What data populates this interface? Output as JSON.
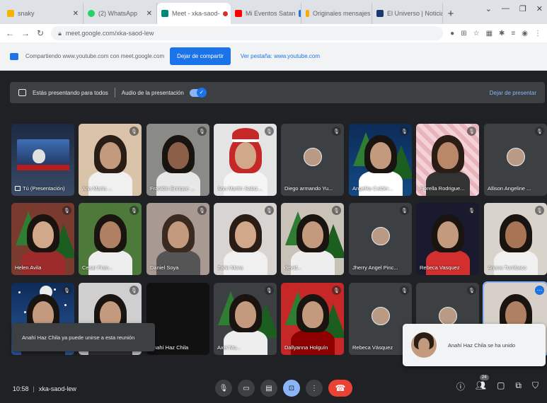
{
  "browser": {
    "tabs": [
      {
        "title": "snaky",
        "color": "#f4b400"
      },
      {
        "title": "(2) WhatsApp",
        "color": "#25d366"
      },
      {
        "title": "Meet - xka-saod-",
        "color": "#00897b"
      },
      {
        "title": "Mi Eventos Satan",
        "color": "#ff0000"
      },
      {
        "title": "Originales mensajes",
        "color": "#f9ab00"
      },
      {
        "title": "El Universo | Noticias",
        "color": "#1a3a6b"
      }
    ],
    "url": "meet.google.com/xka-saod-lew"
  },
  "sharebar": {
    "text": "Compartiendo www.youtube.com con meet.google.com",
    "share_button": "Dejar de compartir",
    "view_link": "Ver pestaña: www.youtube.com"
  },
  "presenting": {
    "status": "Estás presentando para todos",
    "audio_label": "Audio de la presentación",
    "stop_button": "Dejar de presentar"
  },
  "participants": [
    {
      "name": "Tú (Presentación)"
    },
    {
      "name": "Ana Maria ..."
    },
    {
      "name": "Franklin Enrique ..."
    },
    {
      "name": "Ana Martin Salaz..."
    },
    {
      "name": "Diego armando Yu..."
    },
    {
      "name": "Angelita Calder..."
    },
    {
      "name": "Fiorella Rodrigue..."
    },
    {
      "name": "Allison Angeline ..."
    },
    {
      "name": "Helen Avila"
    },
    {
      "name": "Cesar Fran..."
    },
    {
      "name": "Daniel Soya"
    },
    {
      "name": "Zahir Mora"
    },
    {
      "name": "devid..."
    },
    {
      "name": "Jherry Angel Pinc..."
    },
    {
      "name": "Rebeca Vasquez"
    },
    {
      "name": "Ariana Tumbaco"
    },
    {
      "name": ""
    },
    {
      "name": ""
    },
    {
      "name": "Anahí Haz Chila"
    },
    {
      "name": "Axel Mu..."
    },
    {
      "name": "Dallyanna Holguín"
    },
    {
      "name": "Rebeca Vásquez"
    },
    {
      "name": ""
    },
    {
      "name": ""
    }
  ],
  "toasts": {
    "left": "Anahí Haz Chila ya puede unirse a esta reunión",
    "right": "Anahí Haz Chila se ha unido"
  },
  "meeting": {
    "time": "10:58",
    "code": "xka-saod-lew",
    "participant_count": "24"
  },
  "icons": {
    "mute": "mic-off-icon",
    "more": "more-vert-icon"
  }
}
